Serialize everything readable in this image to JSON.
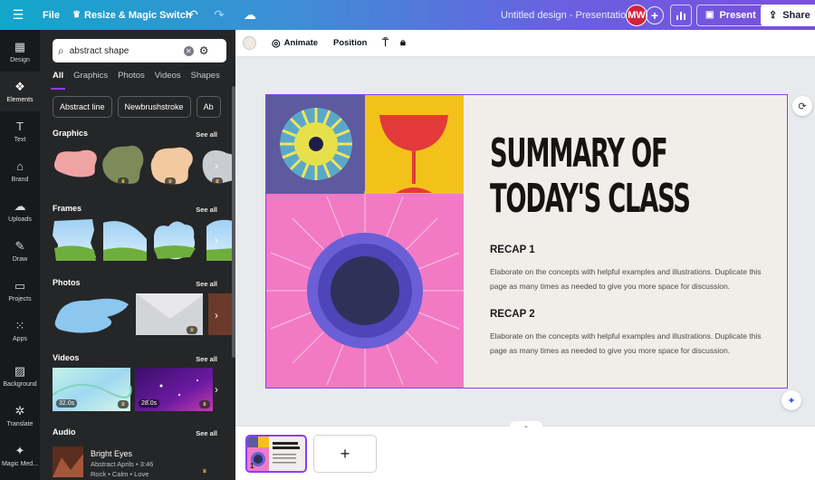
{
  "topbar": {
    "file_label": "File",
    "resize_label": "Resize & Magic Switch",
    "doc_title": "Untitled design - Presentation",
    "avatar_initials": "MW",
    "present_label": "Present",
    "share_label": "Share",
    "icons": [
      "menu-icon",
      "crown-icon",
      "undo-icon",
      "redo-icon",
      "cloud-save-icon",
      "add-people-icon",
      "analytics-icon",
      "present-icon",
      "share-icon"
    ]
  },
  "rail": {
    "items": [
      {
        "label": "Design",
        "icon": "layout-icon"
      },
      {
        "label": "Elements",
        "icon": "shapes-icon",
        "active": true
      },
      {
        "label": "Text",
        "icon": "text-icon"
      },
      {
        "label": "Brand",
        "icon": "brand-icon"
      },
      {
        "label": "Uploads",
        "icon": "upload-cloud-icon"
      },
      {
        "label": "Draw",
        "icon": "pen-icon"
      },
      {
        "label": "Projects",
        "icon": "folder-icon"
      },
      {
        "label": "Apps",
        "icon": "apps-icon"
      },
      {
        "label": "Background",
        "icon": "background-icon"
      },
      {
        "label": "Translate",
        "icon": "translate-icon"
      },
      {
        "label": "Magic Med...",
        "icon": "magic-icon"
      }
    ]
  },
  "panel": {
    "search": {
      "value": "abstract shape"
    },
    "tabs": [
      "All",
      "Graphics",
      "Photos",
      "Videos",
      "Shapes"
    ],
    "chips": [
      "Abstract line",
      "Newbrushstroke",
      "Ab"
    ],
    "sections": {
      "graphics": "Graphics",
      "frames": "Frames",
      "photos": "Photos",
      "videos": "Videos",
      "audio": "Audio",
      "see_all": "See all"
    },
    "videos": [
      {
        "duration": "32.0s"
      },
      {
        "duration": "28.0s"
      }
    ],
    "audio": {
      "title": "Bright Eyes",
      "artist_duration": "Abstract Aprils • 3:46",
      "tags": "Rock • Calm • Love"
    }
  },
  "editor": {
    "animate_label": "Animate",
    "position_label": "Position"
  },
  "slide": {
    "title_line1": "SUMMARY OF",
    "title_line2": "TODAY'S CLASS",
    "recap1_heading": "RECAP 1",
    "recap1_body": "Elaborate on the concepts with helpful examples and illustrations. Duplicate this page as many times as needed to give you more space for discussion.",
    "recap2_heading": "RECAP 2",
    "recap2_body": "Elaborate on the concepts with helpful examples and illustrations. Duplicate this page as many times as needed to give you more space for discussion.",
    "colors": {
      "background": "#f1ede9",
      "purple_tile": "#5d5aa0",
      "yellow_tile": "#f2c21b",
      "pink_tile": "#f27ac4",
      "ring": "#6a5fd6",
      "core": "#2e3259",
      "selection": "#8b3dff"
    }
  },
  "pages": {
    "current": "1",
    "add_label": "+"
  }
}
